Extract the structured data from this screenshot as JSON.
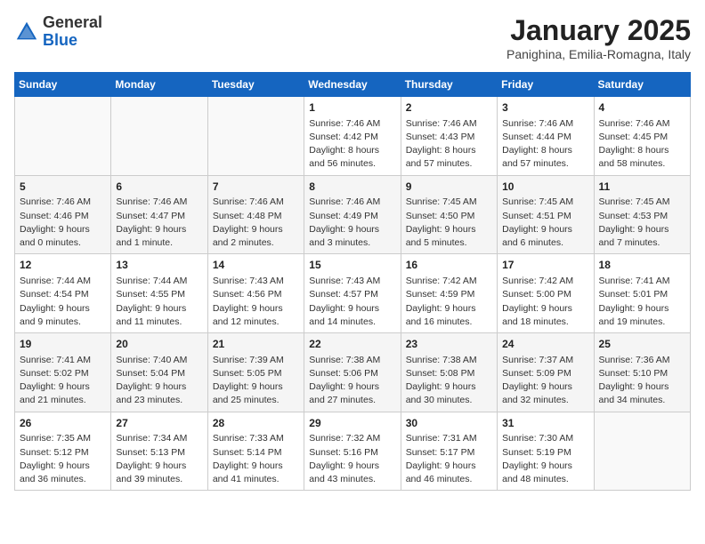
{
  "header": {
    "logo": {
      "general": "General",
      "blue": "Blue"
    },
    "title": "January 2025",
    "location": "Panighina, Emilia-Romagna, Italy"
  },
  "weekdays": [
    "Sunday",
    "Monday",
    "Tuesday",
    "Wednesday",
    "Thursday",
    "Friday",
    "Saturday"
  ],
  "weeks": [
    [
      {
        "day": "",
        "info": ""
      },
      {
        "day": "",
        "info": ""
      },
      {
        "day": "",
        "info": ""
      },
      {
        "day": "1",
        "info": "Sunrise: 7:46 AM\nSunset: 4:42 PM\nDaylight: 8 hours and 56 minutes."
      },
      {
        "day": "2",
        "info": "Sunrise: 7:46 AM\nSunset: 4:43 PM\nDaylight: 8 hours and 57 minutes."
      },
      {
        "day": "3",
        "info": "Sunrise: 7:46 AM\nSunset: 4:44 PM\nDaylight: 8 hours and 57 minutes."
      },
      {
        "day": "4",
        "info": "Sunrise: 7:46 AM\nSunset: 4:45 PM\nDaylight: 8 hours and 58 minutes."
      }
    ],
    [
      {
        "day": "5",
        "info": "Sunrise: 7:46 AM\nSunset: 4:46 PM\nDaylight: 9 hours and 0 minutes."
      },
      {
        "day": "6",
        "info": "Sunrise: 7:46 AM\nSunset: 4:47 PM\nDaylight: 9 hours and 1 minute."
      },
      {
        "day": "7",
        "info": "Sunrise: 7:46 AM\nSunset: 4:48 PM\nDaylight: 9 hours and 2 minutes."
      },
      {
        "day": "8",
        "info": "Sunrise: 7:46 AM\nSunset: 4:49 PM\nDaylight: 9 hours and 3 minutes."
      },
      {
        "day": "9",
        "info": "Sunrise: 7:45 AM\nSunset: 4:50 PM\nDaylight: 9 hours and 5 minutes."
      },
      {
        "day": "10",
        "info": "Sunrise: 7:45 AM\nSunset: 4:51 PM\nDaylight: 9 hours and 6 minutes."
      },
      {
        "day": "11",
        "info": "Sunrise: 7:45 AM\nSunset: 4:53 PM\nDaylight: 9 hours and 7 minutes."
      }
    ],
    [
      {
        "day": "12",
        "info": "Sunrise: 7:44 AM\nSunset: 4:54 PM\nDaylight: 9 hours and 9 minutes."
      },
      {
        "day": "13",
        "info": "Sunrise: 7:44 AM\nSunset: 4:55 PM\nDaylight: 9 hours and 11 minutes."
      },
      {
        "day": "14",
        "info": "Sunrise: 7:43 AM\nSunset: 4:56 PM\nDaylight: 9 hours and 12 minutes."
      },
      {
        "day": "15",
        "info": "Sunrise: 7:43 AM\nSunset: 4:57 PM\nDaylight: 9 hours and 14 minutes."
      },
      {
        "day": "16",
        "info": "Sunrise: 7:42 AM\nSunset: 4:59 PM\nDaylight: 9 hours and 16 minutes."
      },
      {
        "day": "17",
        "info": "Sunrise: 7:42 AM\nSunset: 5:00 PM\nDaylight: 9 hours and 18 minutes."
      },
      {
        "day": "18",
        "info": "Sunrise: 7:41 AM\nSunset: 5:01 PM\nDaylight: 9 hours and 19 minutes."
      }
    ],
    [
      {
        "day": "19",
        "info": "Sunrise: 7:41 AM\nSunset: 5:02 PM\nDaylight: 9 hours and 21 minutes."
      },
      {
        "day": "20",
        "info": "Sunrise: 7:40 AM\nSunset: 5:04 PM\nDaylight: 9 hours and 23 minutes."
      },
      {
        "day": "21",
        "info": "Sunrise: 7:39 AM\nSunset: 5:05 PM\nDaylight: 9 hours and 25 minutes."
      },
      {
        "day": "22",
        "info": "Sunrise: 7:38 AM\nSunset: 5:06 PM\nDaylight: 9 hours and 27 minutes."
      },
      {
        "day": "23",
        "info": "Sunrise: 7:38 AM\nSunset: 5:08 PM\nDaylight: 9 hours and 30 minutes."
      },
      {
        "day": "24",
        "info": "Sunrise: 7:37 AM\nSunset: 5:09 PM\nDaylight: 9 hours and 32 minutes."
      },
      {
        "day": "25",
        "info": "Sunrise: 7:36 AM\nSunset: 5:10 PM\nDaylight: 9 hours and 34 minutes."
      }
    ],
    [
      {
        "day": "26",
        "info": "Sunrise: 7:35 AM\nSunset: 5:12 PM\nDaylight: 9 hours and 36 minutes."
      },
      {
        "day": "27",
        "info": "Sunrise: 7:34 AM\nSunset: 5:13 PM\nDaylight: 9 hours and 39 minutes."
      },
      {
        "day": "28",
        "info": "Sunrise: 7:33 AM\nSunset: 5:14 PM\nDaylight: 9 hours and 41 minutes."
      },
      {
        "day": "29",
        "info": "Sunrise: 7:32 AM\nSunset: 5:16 PM\nDaylight: 9 hours and 43 minutes."
      },
      {
        "day": "30",
        "info": "Sunrise: 7:31 AM\nSunset: 5:17 PM\nDaylight: 9 hours and 46 minutes."
      },
      {
        "day": "31",
        "info": "Sunrise: 7:30 AM\nSunset: 5:19 PM\nDaylight: 9 hours and 48 minutes."
      },
      {
        "day": "",
        "info": ""
      }
    ]
  ]
}
